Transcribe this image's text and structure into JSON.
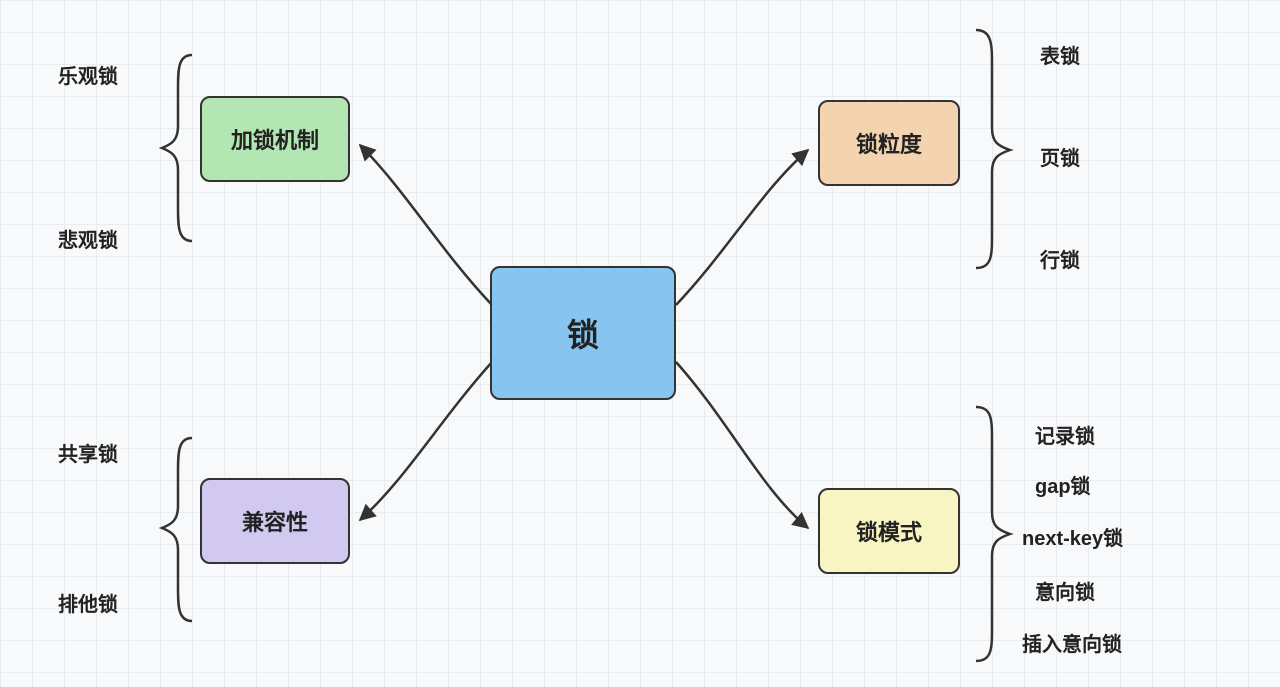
{
  "center": {
    "label": "锁"
  },
  "nodes": {
    "lockMechanism": {
      "label": "加锁机制"
    },
    "compatibility": {
      "label": "兼容性"
    },
    "granularity": {
      "label": "锁粒度"
    },
    "lockMode": {
      "label": "锁模式"
    }
  },
  "sublabels": {
    "lockMechanism": [
      "乐观锁",
      "悲观锁"
    ],
    "compatibility": [
      "共享锁",
      "排他锁"
    ],
    "granularity": [
      "表锁",
      "页锁",
      "行锁"
    ],
    "lockMode": [
      "记录锁",
      "gap锁",
      "next-key锁",
      "意向锁",
      "插入意向锁"
    ]
  }
}
